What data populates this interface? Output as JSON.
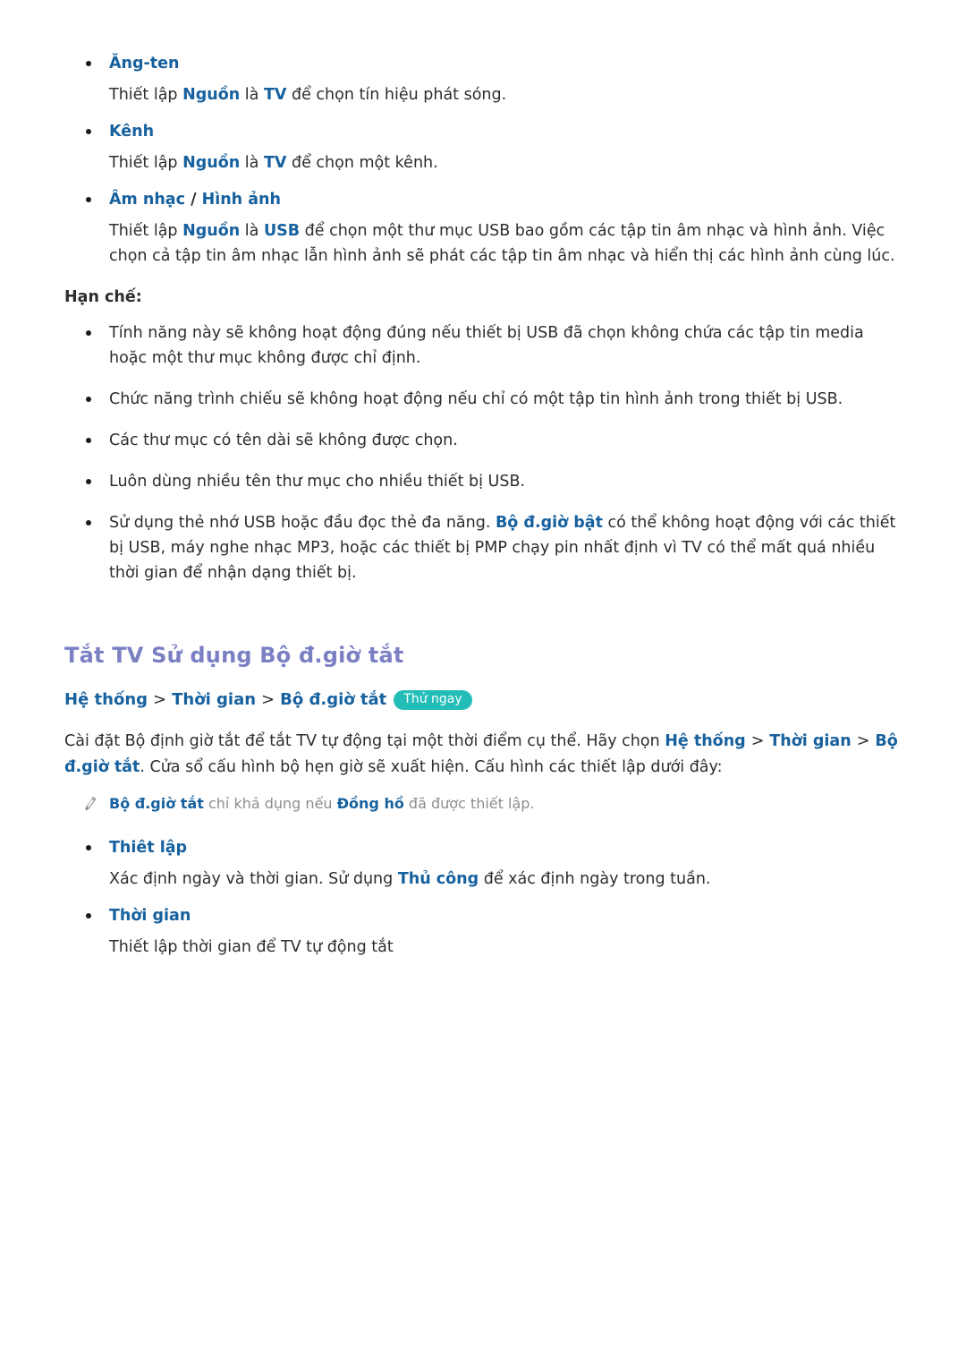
{
  "document": {
    "language": "vi",
    "colors": {
      "keyword_blue": "#17619e",
      "heading_purple": "#7b80c3",
      "badge_teal": "#23bdb8",
      "body_text": "#2d2d2d",
      "note_gray": "#8d8d8d"
    }
  },
  "source_items": [
    {
      "term": "Ăng-ten",
      "term_suffix": "",
      "desc_pre": "Thiết lập ",
      "kw1": "Nguồn",
      "desc_mid": " là ",
      "kw2": "TV",
      "desc_post": " để chọn tín hiệu phát sóng."
    },
    {
      "term": "Kênh",
      "term_suffix": "",
      "desc_pre": "Thiết lập ",
      "kw1": "Nguồn",
      "desc_mid": " là ",
      "kw2": "TV",
      "desc_post": " để chọn một kênh."
    },
    {
      "term": "Âm nhạc",
      "term_separator": " / ",
      "term2": "Hình ảnh",
      "desc_pre": "Thiết lập ",
      "kw1": "Nguồn",
      "desc_mid": " là ",
      "kw2": "USB",
      "desc_post": " để chọn một thư mục USB bao gồm các tập tin âm nhạc và hình ảnh. Việc chọn cả tập tin âm nhạc lẫn hình ảnh sẽ phát các tập tin âm nhạc và hiển thị các hình ảnh cùng lúc."
    }
  ],
  "restrictions": {
    "label": "Hạn chế:",
    "items": [
      {
        "text_pre": "Tính năng này sẽ không hoạt động đúng nếu thiết bị USB đã chọn không chứa các tập tin media hoặc một thư mục không được chỉ định.",
        "kw": "",
        "text_post": ""
      },
      {
        "text_pre": "Chức năng trình chiếu sẽ không hoạt động nếu chỉ có một tập tin hình ảnh trong thiết bị USB.",
        "kw": "",
        "text_post": ""
      },
      {
        "text_pre": "Các thư mục có tên dài sẽ không được chọn.",
        "kw": "",
        "text_post": ""
      },
      {
        "text_pre": "Luôn dùng nhiều tên thư mục cho nhiều thiết bị USB.",
        "kw": "",
        "text_post": ""
      },
      {
        "text_pre": "Sử dụng thẻ nhớ USB hoặc đầu đọc thẻ đa năng. ",
        "kw": "Bộ đ.giờ bật",
        "text_post": " có thể không hoạt động với các thiết bị USB, máy nghe nhạc MP3, hoặc các thiết bị PMP chạy pin nhất định vì TV có thể mất quá nhiều thời gian để nhận dạng thiết bị."
      }
    ]
  },
  "off_timer_section": {
    "heading": "Tắt TV Sử dụng Bộ đ.giờ tắt",
    "path": {
      "items": [
        "Hệ thống",
        "Thời gian",
        "Bộ đ.giờ tắt"
      ],
      "separator": ">",
      "badge": "Thử ngay"
    },
    "intro": {
      "part1": "Cài đặt Bộ định giờ tắt để tắt TV tự động tại một thời điểm cụ thể. Hãy chọn ",
      "path1": "Hệ thống",
      "sep1": ">",
      "path2": "Thời gian",
      "sep2": ">",
      "path3": "Bộ đ.giờ tắt",
      "part2": ". Cửa sổ cấu hình bộ hẹn giờ sẽ xuất hiện. Cấu hình các thiết lập dưới đây:"
    },
    "note": {
      "icon": "pencil-icon",
      "kw1": "Bộ đ.giờ tắt",
      "text_mid": " chỉ khả dụng nếu ",
      "kw2": "Đồng hồ",
      "text_post": " đã được thiết lập."
    },
    "settings": [
      {
        "term": "Thiêt lập",
        "desc_pre": "Xác định ngày và thời gian. Sử dụng ",
        "kw": "Thủ công",
        "desc_post": " để xác định ngày trong tuần."
      },
      {
        "term": "Thời gian",
        "desc_pre": "Thiết lập thời gian để TV tự động tắt",
        "kw": "",
        "desc_post": ""
      }
    ]
  }
}
